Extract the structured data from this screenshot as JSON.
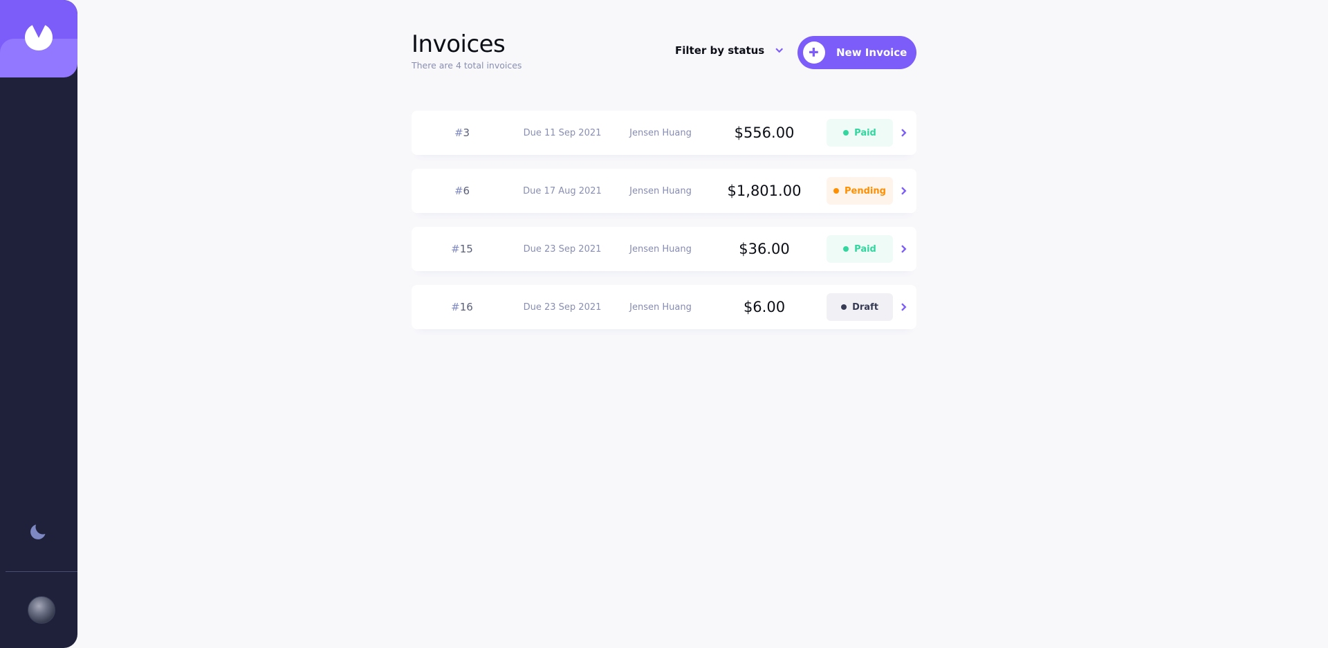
{
  "header": {
    "title": "Invoices",
    "subtitle": "There are 4 total invoices",
    "filter_label": "Filter by status",
    "new_invoice_label": "New Invoice"
  },
  "invoices": [
    {
      "hash": "#",
      "id": "3",
      "due": "Due 11 Sep 2021",
      "client": "Jensen Huang",
      "amount": "$556.00",
      "status": "Paid"
    },
    {
      "hash": "#",
      "id": "6",
      "due": "Due 17 Aug 2021",
      "client": "Jensen Huang",
      "amount": "$1,801.00",
      "status": "Pending"
    },
    {
      "hash": "#",
      "id": "15",
      "due": "Due 23 Sep 2021",
      "client": "Jensen Huang",
      "amount": "$36.00",
      "status": "Paid"
    },
    {
      "hash": "#",
      "id": "16",
      "due": "Due 23 Sep 2021",
      "client": "Jensen Huang",
      "amount": "$6.00",
      "status": "Draft"
    }
  ],
  "colors": {
    "accent": "#7c5dfa",
    "accent_light": "#9277ff",
    "sidebar": "#1e2139",
    "paid": "#33d69f",
    "pending": "#ff8f00",
    "draft": "#373b53"
  },
  "icons": {
    "logo": "logo-icon",
    "theme": "moon-icon",
    "filter": "chevron-down-icon",
    "new": "plus-icon",
    "row": "chevron-right-icon"
  }
}
